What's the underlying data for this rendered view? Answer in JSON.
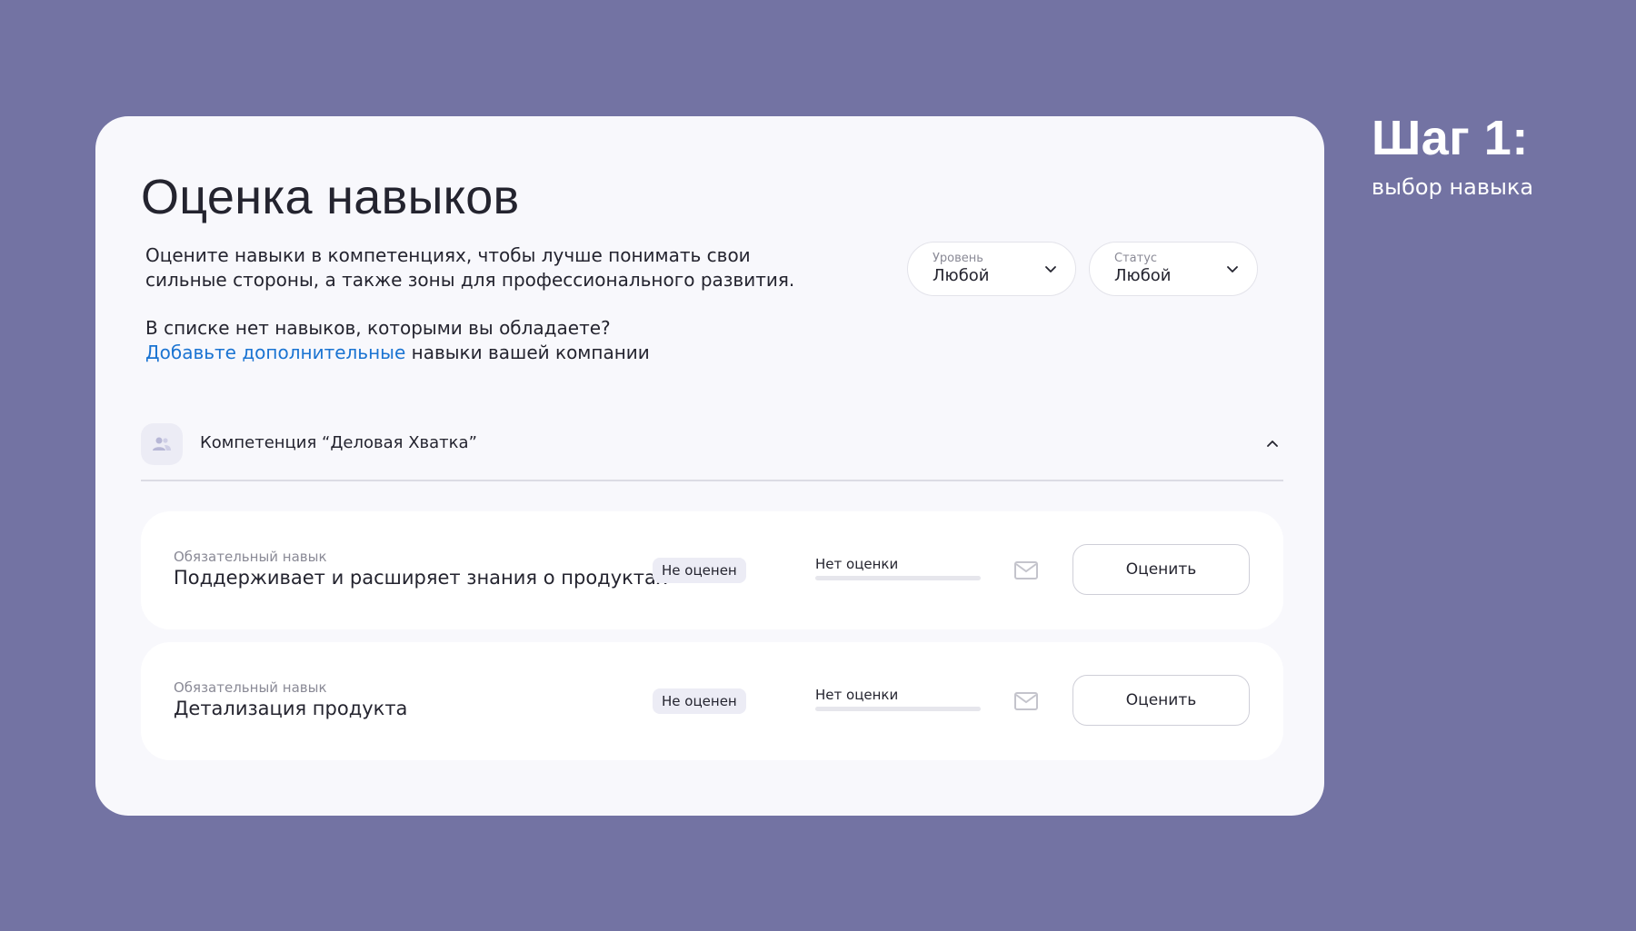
{
  "step": {
    "title": "Шаг 1:",
    "subtitle": "выбор навыка"
  },
  "page": {
    "title": "Оценка навыков",
    "intro": "Оцените навыки в компетенциях, чтобы лучше понимать свои сильные стороны, а также зоны для профессионального развития.",
    "question": "В списке нет навыков, которыми вы обладаете?",
    "add_link": "Добавьте дополнительные",
    "add_suffix": " навыки вашей компании"
  },
  "filters": [
    {
      "label": "Уровень",
      "value": "Любой"
    },
    {
      "label": "Статус",
      "value": "Любой"
    }
  ],
  "competency": {
    "title": "Компетенция “Деловая Хватка”",
    "icon": "people-icon"
  },
  "skills": [
    {
      "kind": "Обязательный навык",
      "name": "Поддерживает и расширяет знания о продуктах",
      "status": "Не оценен",
      "rating_label": "Нет оценки",
      "rating_progress": 0,
      "button": "Оценить"
    },
    {
      "kind": "Обязательный навык",
      "name": "Детализация продукта",
      "status": "Не оценен",
      "rating_label": "Нет оценки",
      "rating_progress": 0,
      "button": "Оценить"
    }
  ],
  "colors": {
    "background": "#7373a3",
    "card": "#f8f8fc",
    "link": "#1b74d2",
    "text": "#24242f"
  }
}
